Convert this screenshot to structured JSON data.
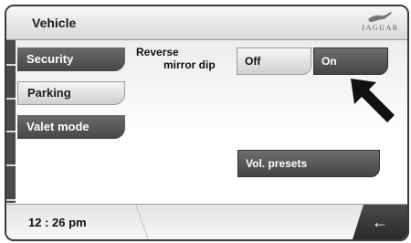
{
  "header": {
    "title": "Vehicle",
    "logo_text": "JAGUAR",
    "logo_icon": "jaguar-leaper-icon"
  },
  "sidebar": {
    "items": [
      {
        "label": "Security",
        "selected": true
      },
      {
        "label": "Parking",
        "selected": false
      },
      {
        "label": "Valet mode",
        "selected": false
      }
    ]
  },
  "settings": {
    "reverse_mirror_dip": {
      "label_line1": "Reverse",
      "label_line2": "mirror dip",
      "off_label": "Off",
      "on_label": "On",
      "selected": "On"
    },
    "vol_presets_label": "Vol. presets"
  },
  "pointer_icon": "arrow-pointer-icon",
  "footer": {
    "time": "12 : 26 pm",
    "back_icon": "back-arrow-icon"
  },
  "colors": {
    "dark_button": "#474747",
    "light_button": "#cfcfcf"
  }
}
